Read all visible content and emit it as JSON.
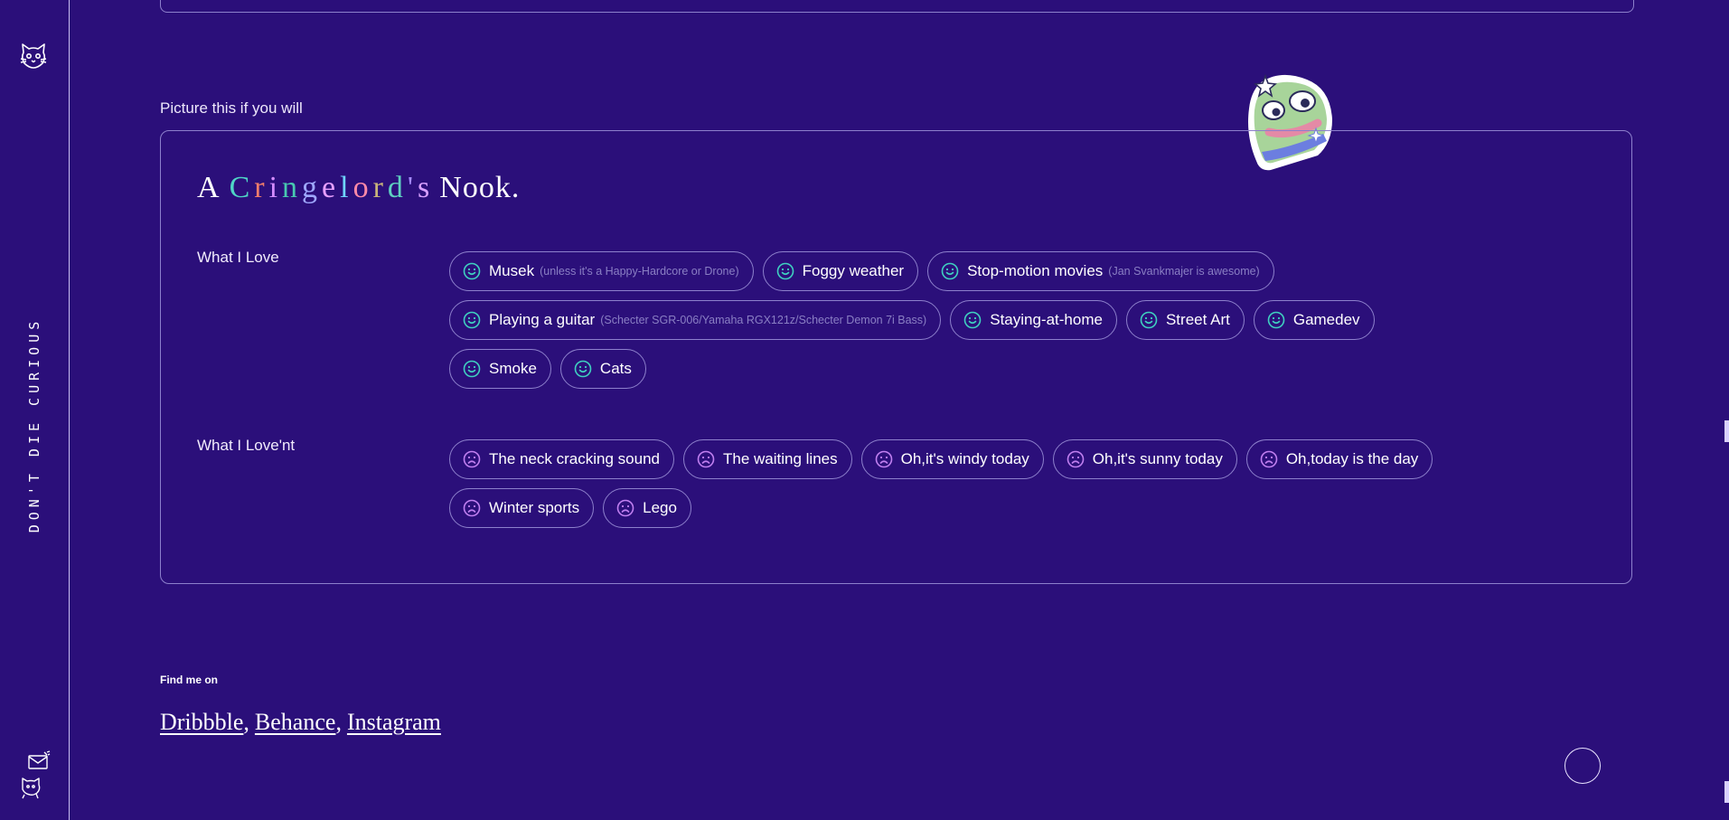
{
  "sidebar": {
    "vertical_text": "DON'T DIE CURIOUS",
    "logo_icon": "cat-face-icon",
    "mail_icon": "mail-icon",
    "cat_icon": "cat-icon"
  },
  "section": {
    "label": "Picture this if you will"
  },
  "card": {
    "title_prefix": "A",
    "title_colored": "Cringelord's",
    "title_suffix": "Nook.",
    "title_colors": [
      "#4fd6c6",
      "#f07d6b",
      "#d58cff",
      "#48c9b0",
      "#9fa8ff",
      "#e7a0ff",
      "#6fd5ff",
      "#ff8aa8",
      "#c9b47a",
      "#5fd0c0",
      "#a58bff",
      "#d8a0ff"
    ],
    "love_label": "What I Love",
    "lovent_label": "What I Love'nt",
    "love_items": [
      {
        "label": "Musek",
        "note": "(unless it's a Happy-Hardcore or Drone)"
      },
      {
        "label": "Foggy weather",
        "note": ""
      },
      {
        "label": "Stop-motion movies",
        "note": "(Jan Svankmajer is awesome)"
      },
      {
        "label": "Playing a guitar",
        "note": "(Schecter SGR-006/Yamaha RGX121z/Schecter Demon 7i Bass)"
      },
      {
        "label": "Staying-at-home",
        "note": ""
      },
      {
        "label": "Street Art",
        "note": ""
      },
      {
        "label": "Gamedev",
        "note": ""
      },
      {
        "label": "Smoke",
        "note": ""
      },
      {
        "label": "Cats",
        "note": ""
      }
    ],
    "lovent_items": [
      {
        "label": "The neck cracking sound"
      },
      {
        "label": "The waiting lines"
      },
      {
        "label": "Oh,it's windy today"
      },
      {
        "label": "Oh,it's sunny today"
      },
      {
        "label": "Oh,today is the day"
      },
      {
        "label": "Winter sports"
      },
      {
        "label": "Lego"
      }
    ],
    "happy_color": "#3fd0c0",
    "sad_color": "#c07ff0"
  },
  "footer": {
    "find_label": "Find me on",
    "links": [
      "Dribbble",
      "Behance",
      "Instagram"
    ]
  },
  "colors": {
    "background": "#2b0f7a",
    "border": "#8d80cc"
  }
}
